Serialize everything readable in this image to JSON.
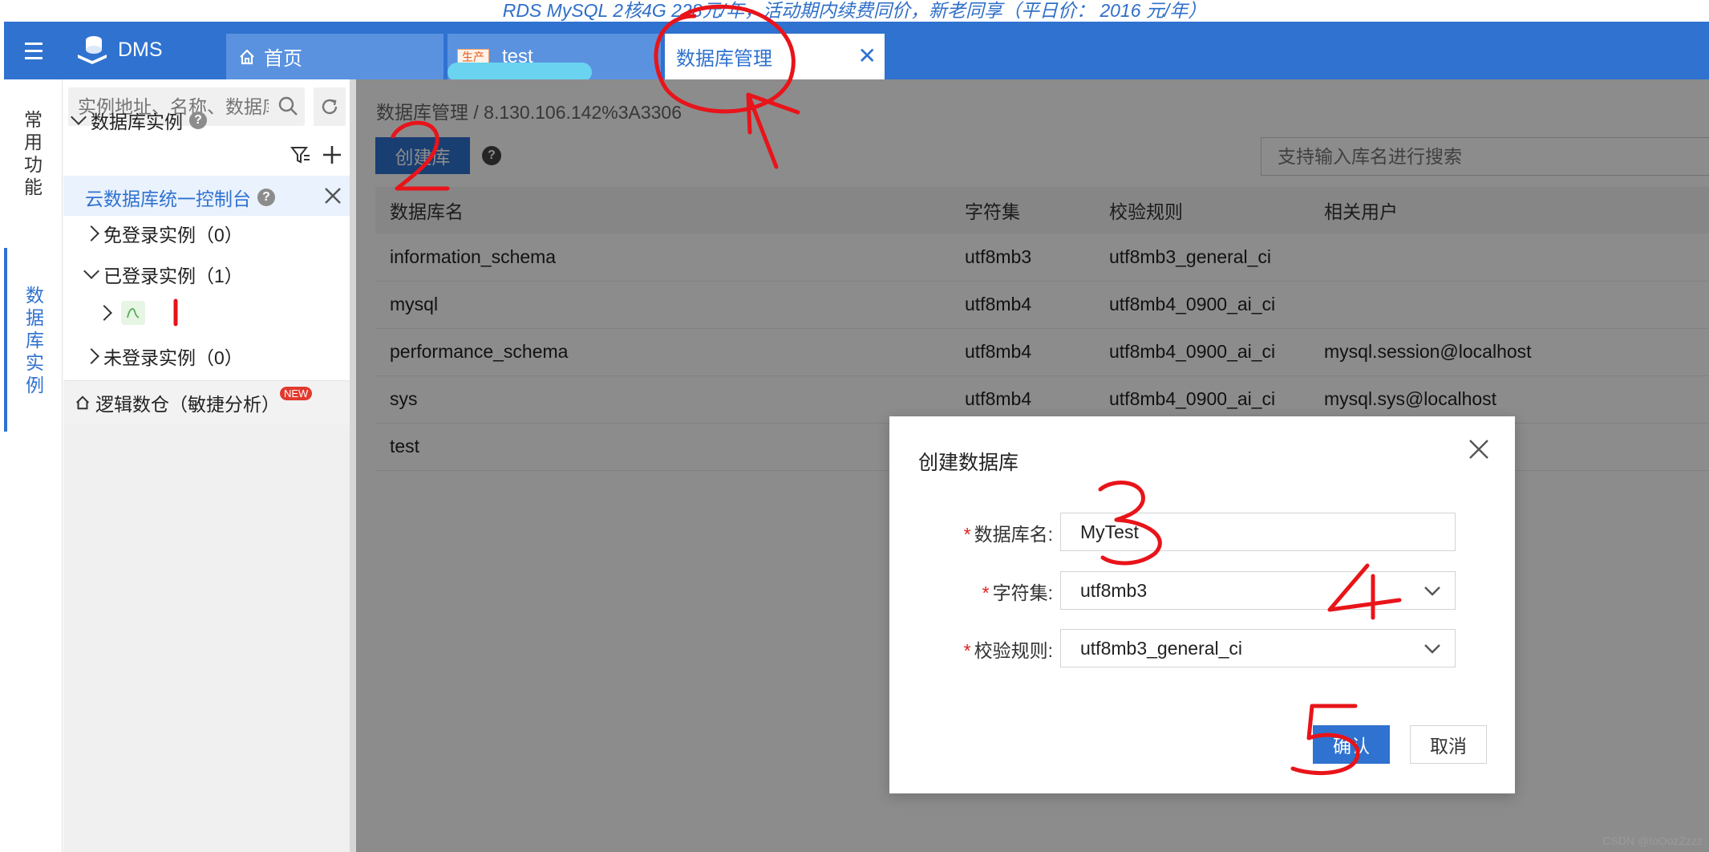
{
  "promo": {
    "text": "RDS MySQL 2核4G 228元/年，活动期内续费同价，新老同享（平日价： 2016 元/年）"
  },
  "topbar": {
    "brand": "DMS",
    "tabs": [
      {
        "label": "首页",
        "icon": "home-icon"
      },
      {
        "label": "test",
        "env": "生产"
      },
      {
        "label": "数据库管理",
        "active": true
      }
    ]
  },
  "rail": {
    "common": [
      "常",
      "用",
      "功",
      "能"
    ],
    "db": [
      "数",
      "据",
      "库",
      "实",
      "例"
    ]
  },
  "sidebar": {
    "search_placeholder": "实例地址、名称、数据库",
    "header": "数据库实例",
    "cloud_console": "云数据库统一控制台",
    "items": [
      {
        "label": "免登录实例（0）"
      },
      {
        "label": "已登录实例（1）"
      },
      {
        "label": "未登录实例（0）"
      }
    ],
    "logic": "逻辑数仓（敏捷分析）",
    "new_badge": "NEW"
  },
  "main": {
    "breadcrumb": "数据库管理 / 8.130.106.142%3A3306",
    "create_button": "创建库",
    "search_placeholder": "支持输入库名进行搜索",
    "columns": [
      "数据库名",
      "字符集",
      "校验规则",
      "相关用户"
    ],
    "rows": [
      [
        "information_schema",
        "utf8mb3",
        "utf8mb3_general_ci",
        ""
      ],
      [
        "mysql",
        "utf8mb4",
        "utf8mb4_0900_ai_ci",
        ""
      ],
      [
        "performance_schema",
        "utf8mb4",
        "utf8mb4_0900_ai_ci",
        "mysql.session@localhost"
      ],
      [
        "sys",
        "utf8mb4",
        "utf8mb4_0900_ai_ci",
        "mysql.sys@localhost"
      ],
      [
        "test",
        "",
        "",
        ""
      ]
    ]
  },
  "modal": {
    "title": "创建数据库",
    "fields": [
      {
        "label": "数据库名:",
        "value": "MyTest"
      },
      {
        "label": "字符集:",
        "value": "utf8mb3"
      },
      {
        "label": "校验规则:",
        "value": "utf8mb3_general_ci"
      }
    ],
    "ok": "确认",
    "cancel": "取消"
  },
  "annotations": [
    "1",
    "2",
    "3",
    "4",
    "5"
  ],
  "watermark": "CSDN @IoOozZzzz",
  "colors": {
    "primary": "#2f72d0",
    "required": "#e02020",
    "annotation": "#e8141a"
  }
}
